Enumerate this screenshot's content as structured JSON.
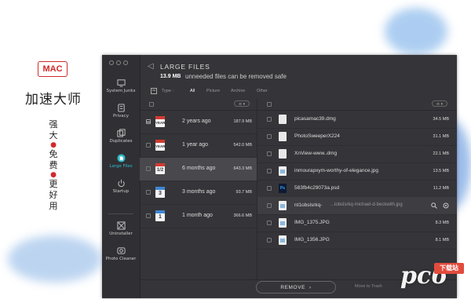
{
  "promo": {
    "badge": "MAC",
    "title": "加速大师",
    "slogan": [
      "强",
      "大",
      "免",
      "费",
      "更",
      "好",
      "用"
    ]
  },
  "sidebar": {
    "items": [
      {
        "label": "System Junks",
        "icon": "monitor-icon"
      },
      {
        "label": "Privacy",
        "icon": "privacy-icon"
      },
      {
        "label": "Duplicates",
        "icon": "duplicates-icon"
      },
      {
        "label": "Large Files",
        "icon": "large-files-icon",
        "active": true
      },
      {
        "label": "Startup",
        "icon": "power-icon"
      },
      {
        "label": "Uninstaller",
        "icon": "uninstaller-icon"
      },
      {
        "label": "Photo Cleaner",
        "icon": "photo-cleaner-icon"
      }
    ]
  },
  "header": {
    "back": "◁",
    "title": "LARGE FILES",
    "size": "13.9 MB",
    "subtitle": "unneeded files can be removed safe"
  },
  "filters": {
    "type_label": "Type :",
    "options": [
      "All",
      "Picture",
      "Archive",
      "Other"
    ]
  },
  "groups": [
    {
      "label": "2 years ago",
      "size": "187.9 MB",
      "icon": "YEAR 2"
    },
    {
      "label": "1 year ago",
      "size": "542.0 MB",
      "icon": "YEAR 1"
    },
    {
      "label": "6 months ago",
      "size": "643.3 MB",
      "icon": "1/2",
      "selected": true
    },
    {
      "label": "3 months ago",
      "size": "93.7 MB",
      "icon": "3"
    },
    {
      "label": "1 month ago",
      "size": "366.6 MB",
      "icon": "1"
    }
  ],
  "files": [
    {
      "name": "picasamac39.dmg",
      "size": "34.5 MB",
      "kind": "doc"
    },
    {
      "name": "PhotoSweeperX224",
      "size": "31.1 MB",
      "kind": "doc"
    },
    {
      "name": "XnView-www..dmg",
      "size": "22.1 MB",
      "kind": "doc"
    },
    {
      "name": "inmourapxym-worthy-of-elegance.jpg",
      "size": "13.5 MB",
      "kind": "img"
    },
    {
      "name": "583fb4c29073a.psd",
      "size": "11.2 MB",
      "kind": "ps"
    },
    {
      "name": "nt1obslsrkq-",
      "path": "...lobslsrkq-michael-d-beckwith.jpg",
      "size": "",
      "kind": "img"
    },
    {
      "name": "IMG_1375.JPG",
      "size": "8.3 MB",
      "kind": "img"
    },
    {
      "name": "IMG_1356.JPG",
      "size": "8.1 MB",
      "kind": "img"
    }
  ],
  "footer": {
    "remove": "REMOVE",
    "hint": "Move to Trash"
  },
  "watermark": {
    "text": "pc6",
    "badge": "下载站"
  },
  "colors": {
    "accent": "#2fb9c7",
    "brand_red": "#d02a2a",
    "panel": "#353539"
  }
}
